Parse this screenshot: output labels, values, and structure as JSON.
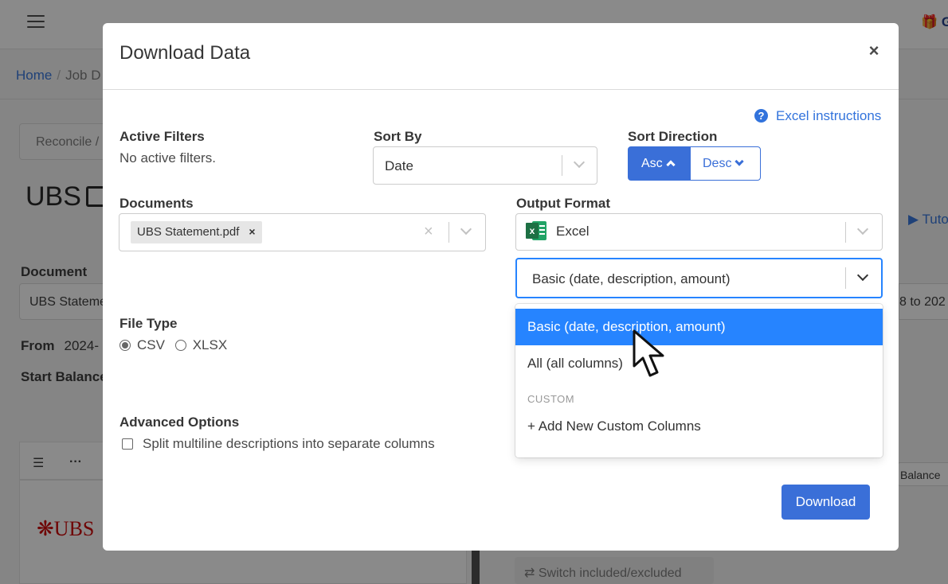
{
  "background": {
    "breadcrumb": {
      "home": "Home",
      "separator": "/",
      "current": "Job D"
    },
    "tab_label": "Reconcile /",
    "page_title": "UBS",
    "document_label": "Document",
    "document_value": "UBS Stateme",
    "from_label": "From",
    "from_value": "2024-",
    "start_balance_label": "Start Balance",
    "tutorial_link": "Tuto",
    "date_range_value": "8 to 202",
    "balance_button": "Balance",
    "switch_button": "Switch included/excluded",
    "bank_logo_text": "UBS",
    "gift_text": "G",
    "toolbar_icons": [
      "list-icon",
      "more-icon"
    ]
  },
  "modal": {
    "title": "Download Data",
    "close_label": "×",
    "help_icon_glyph": "?",
    "help_link": "Excel instructions",
    "active_filters": {
      "label": "Active Filters",
      "value": "No active filters."
    },
    "sort_by": {
      "label": "Sort By",
      "value": "Date"
    },
    "sort_direction": {
      "label": "Sort Direction",
      "asc": "Asc",
      "desc": "Desc",
      "selected": "Asc"
    },
    "documents": {
      "label": "Documents",
      "tags": [
        "UBS Statement.pdf"
      ],
      "tag_remove": "×",
      "clear": "×"
    },
    "output_format": {
      "label": "Output Format",
      "value": "Excel",
      "icon": "excel-icon",
      "icon_letter": "x",
      "columns_value": "Basic (date, description, amount)",
      "options": [
        {
          "label": "Basic (date, description, amount)",
          "selected": true
        },
        {
          "label": "All (all columns)",
          "selected": false
        }
      ],
      "custom_group_label": "CUSTOM",
      "add_custom": "+ Add New Custom Columns"
    },
    "file_type": {
      "label": "File Type",
      "options": [
        "CSV",
        "XLSX"
      ],
      "selected": "CSV"
    },
    "advanced_options": {
      "label": "Advanced Options",
      "split_multiline": "Split multiline descriptions into separate columns",
      "split_multiline_checked": false
    },
    "download_button": "Download"
  },
  "colors": {
    "primary": "#3a6fd8",
    "option_selected": "#2684ff",
    "overlay": "rgba(10,10,10,0.48)"
  }
}
